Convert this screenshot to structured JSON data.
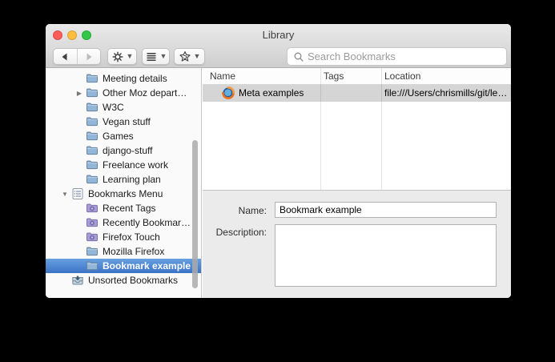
{
  "window": {
    "title": "Library"
  },
  "toolbar": {
    "back": {
      "icon": "back-arrow"
    },
    "forward": {
      "icon": "forward-arrow",
      "disabled": true
    },
    "organize_button": {
      "icon": "gear"
    },
    "views_button": {
      "icon": "list-lines"
    },
    "import_backup_button": {
      "icon": "star-refresh"
    },
    "search": {
      "icon": "magnifier",
      "placeholder": "Search Bookmarks",
      "value": ""
    }
  },
  "sidebar": {
    "items": [
      {
        "label": "Meeting details",
        "icon": "folder",
        "level": 2
      },
      {
        "label": "Other Moz depart…",
        "icon": "folder",
        "level": 2,
        "disclosure": "collapsed"
      },
      {
        "label": "W3C",
        "icon": "folder",
        "level": 2
      },
      {
        "label": "Vegan stuff",
        "icon": "folder",
        "level": 2
      },
      {
        "label": "Games",
        "icon": "folder",
        "level": 2
      },
      {
        "label": "django-stuff",
        "icon": "folder",
        "level": 2
      },
      {
        "label": "Freelance work",
        "icon": "folder",
        "level": 2
      },
      {
        "label": "Learning plan",
        "icon": "folder",
        "level": 2
      },
      {
        "label": "Bookmarks Menu",
        "icon": "menu-list",
        "level": 1,
        "disclosure": "expanded"
      },
      {
        "label": "Recent Tags",
        "icon": "smart-folder",
        "level": 2
      },
      {
        "label": "Recently Bookmar…",
        "icon": "smart-folder",
        "level": 2
      },
      {
        "label": "Firefox Touch",
        "icon": "smart-folder",
        "level": 2
      },
      {
        "label": "Mozilla Firefox",
        "icon": "folder",
        "level": 2
      },
      {
        "label": "Bookmark example",
        "icon": "folder",
        "level": 2,
        "selected": true
      },
      {
        "label": "Unsorted Bookmarks",
        "icon": "inbox",
        "level": 1
      }
    ]
  },
  "list": {
    "columns": [
      {
        "label": "Name"
      },
      {
        "label": "Tags"
      },
      {
        "label": "Location"
      }
    ],
    "rows": [
      {
        "icon": "firefox",
        "name": "Meta examples",
        "tags": "",
        "location": "file:///Users/chrismills/git/le…",
        "selected": true
      }
    ]
  },
  "details": {
    "name_label": "Name:",
    "name_value": "Bookmark example",
    "description_label": "Description:",
    "description_value": ""
  },
  "colors": {
    "selection_blue_top": "#68a0e2",
    "selection_blue_bottom": "#3b73c6",
    "inactive_selection_gray": "#d5d5d5",
    "chrome_gradient_top": "#e9e9e9",
    "chrome_gradient_bottom": "#cdcdcd",
    "folder_blue": "#92b6d8",
    "smart_folder_purple": "#a89ed4",
    "traffic_red": "#fc5b57",
    "traffic_yellow": "#fdbe40",
    "traffic_green": "#33c748"
  }
}
